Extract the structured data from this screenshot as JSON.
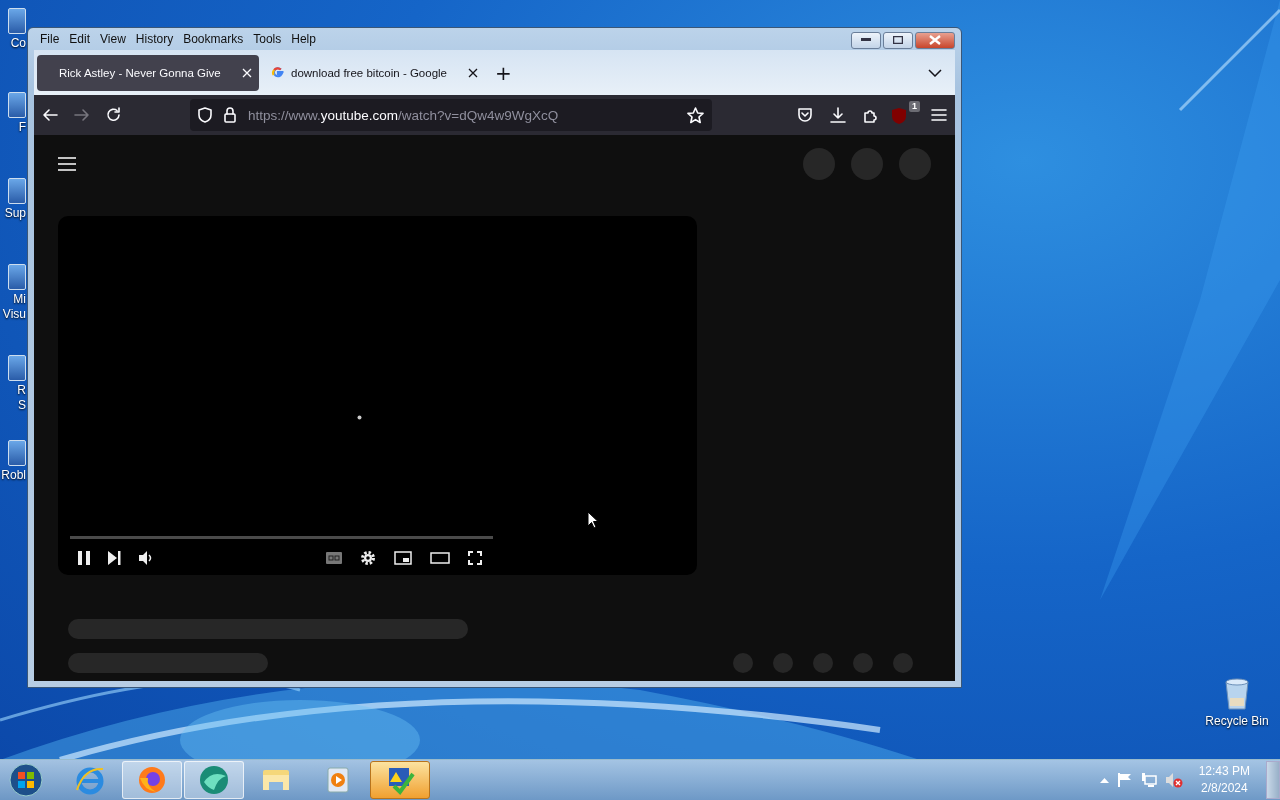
{
  "desktop_icons": [
    {
      "lines": [
        "Co"
      ]
    },
    {
      "lines": [
        "F"
      ]
    },
    {
      "lines": [
        "Sup"
      ]
    },
    {
      "lines": [
        "Mi",
        "Visu"
      ]
    },
    {
      "lines": [
        "R",
        "S"
      ]
    },
    {
      "lines": [
        "Robl"
      ]
    }
  ],
  "recycle_bin": {
    "label": "Recycle Bin"
  },
  "window": {
    "menu": [
      "File",
      "Edit",
      "View",
      "History",
      "Bookmarks",
      "Tools",
      "Help"
    ],
    "tabs": [
      {
        "title": "Rick Astley - Never Gonna Give",
        "selected": true,
        "favicon": false
      },
      {
        "title": "download free bitcoin - Google",
        "selected": false,
        "favicon": true
      }
    ],
    "new_tab": "+",
    "url": {
      "prefix": "https://www.",
      "domain": "youtube.com",
      "path": "/watch?v=dQw4w9WgXcQ"
    },
    "extension_badge": "1"
  },
  "taskbar": {
    "items": [
      {
        "kind": "ie",
        "running": false,
        "flashing": false
      },
      {
        "kind": "firefox",
        "running": true,
        "flashing": false
      },
      {
        "kind": "teal",
        "running": true,
        "flashing": false
      },
      {
        "kind": "explorer",
        "running": false,
        "flashing": false
      },
      {
        "kind": "media",
        "running": false,
        "flashing": false
      },
      {
        "kind": "action",
        "running": true,
        "flashing": true
      }
    ],
    "time": "12:43 PM",
    "date": "2/8/2024"
  }
}
